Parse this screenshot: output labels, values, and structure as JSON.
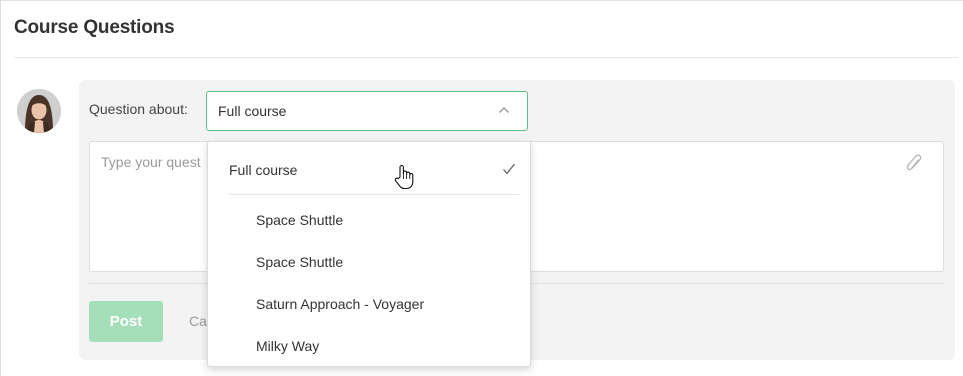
{
  "page": {
    "title": "Course Questions"
  },
  "question_form": {
    "question_about_label": "Question about:",
    "selected_value": "Full course",
    "textarea_placeholder": "Type your quest",
    "post_label": "Post",
    "cancel_label": "Ca"
  },
  "dropdown": {
    "options": [
      {
        "label": "Full course",
        "selected": true
      },
      {
        "label": "Space Shuttle",
        "selected": false
      },
      {
        "label": "Space Shuttle",
        "selected": false
      },
      {
        "label": "Saturn Approach - Voyager",
        "selected": false
      },
      {
        "label": "Milky Way",
        "selected": false
      }
    ]
  },
  "icons": {
    "select_toggle": "chevron-up-icon",
    "attachment": "paperclip-icon",
    "selected_marker": "check-icon",
    "pointer": "hand-cursor-icon"
  },
  "colors": {
    "accent": "#5cbf82",
    "post_button": "#a5dfba",
    "panel_background": "#f3f3f3",
    "placeholder": "#9a9a9a"
  }
}
